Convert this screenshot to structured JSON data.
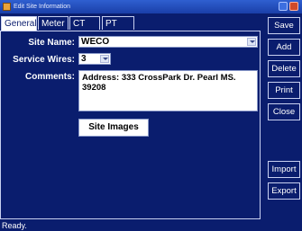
{
  "window": {
    "title": "Edit Site Information"
  },
  "tabs": [
    {
      "label": "General",
      "active": true
    },
    {
      "label": "Meter",
      "active": false
    },
    {
      "label": "CT",
      "active": false
    },
    {
      "label": "PT",
      "active": false
    }
  ],
  "form": {
    "site_name_label": "Site Name:",
    "site_name_value": "WECO",
    "service_wires_label": "Service Wires:",
    "service_wires_value": "3",
    "comments_label": "Comments:",
    "comments_value": "Address: 333 CrossPark Dr. Pearl MS. 39208",
    "site_images_button": "Site Images"
  },
  "side_buttons": {
    "save": "Save",
    "add": "Add",
    "delete": "Delete",
    "print": "Print",
    "close": "Close",
    "import": "Import",
    "export": "Export"
  },
  "status": "Ready."
}
